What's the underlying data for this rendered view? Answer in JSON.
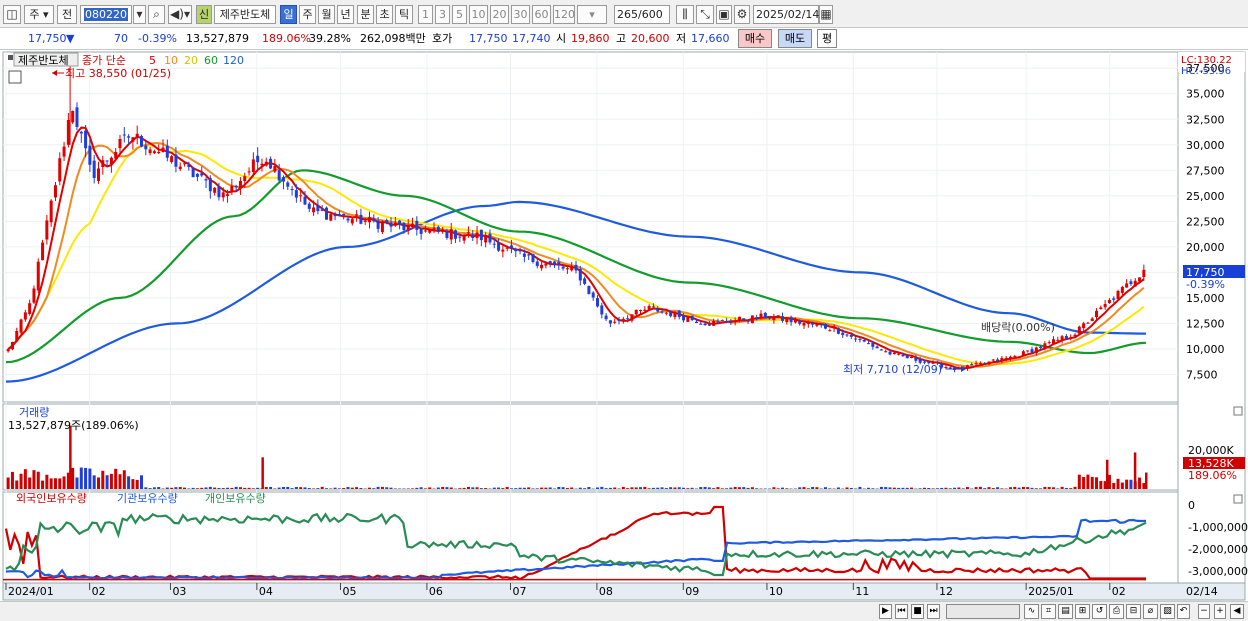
{
  "toolbar": {
    "market_label": "주",
    "range_label": "전",
    "code": "080220",
    "new_badge": "신",
    "stock_name": "제주반도체",
    "periods": [
      "일",
      "주",
      "월",
      "년",
      "분",
      "초",
      "틱"
    ],
    "selected_period": "일",
    "intervals": [
      "1",
      "3",
      "5",
      "10",
      "20",
      "30",
      "60",
      "120"
    ],
    "count": "265",
    "count_max": "/600",
    "date": "2025/02/14"
  },
  "quote": {
    "price": "17,750",
    "direction": "▼",
    "change": "70",
    "change_pct": "-0.39%",
    "volume": "13,527,879",
    "volume_ratio": "189.06%",
    "turnover_ratio": "39.28%",
    "amount": "262,098백만",
    "bid_label": "호가",
    "ask_price": "17,750",
    "bid_price": "17,740",
    "open_label": "시",
    "open": "19,860",
    "high_label": "고",
    "high": "20,600",
    "low_label": "저",
    "low": "17,660",
    "buy_button": "매수",
    "sell_button": "매도",
    "avg_button": "평"
  },
  "price_panel": {
    "stock_name": "제주반도체",
    "ma_legend_prefix": "종가 단순",
    "ma_periods": [
      "5",
      "10",
      "20",
      "60",
      "120"
    ],
    "ma_colors": [
      "#e00000",
      "#f08a20",
      "#ffe800",
      "#129c2c",
      "#1f5be0"
    ],
    "lc": "LC:130.22",
    "hc": "HC:-53.96",
    "high_annotation": "최고 38,550 (01/25)",
    "low_annotation": "최저 7,710 (12/09)",
    "dividend_annotation": "배당락(0.00%)",
    "y_ticks": [
      "37,500",
      "35,000",
      "32,500",
      "30,000",
      "27,500",
      "25,000",
      "22,500",
      "20,000",
      "17,500",
      "15,000",
      "12,500",
      "10,000",
      "7,500"
    ],
    "current_price": "17,750",
    "current_change": "-0.39%"
  },
  "volume_panel": {
    "title": "거래량",
    "value_label": "13,527,879주(189.06%)",
    "y_tick": "20,000K",
    "current_volume": "13,528K",
    "current_ratio": "189.06%"
  },
  "holdings_panel": {
    "legend": [
      "외국인보유수량",
      "기관보유수량",
      "개인보유수량"
    ],
    "legend_colors": [
      "#d00000",
      "#1f5be0",
      "#2a8c55"
    ],
    "y_ticks": [
      "0",
      "-1,000,000",
      "-2,000,000",
      "-3,000,000"
    ]
  },
  "x_axis": {
    "labels": [
      "2024/01",
      "02",
      "03",
      "04",
      "05",
      "06",
      "07",
      "08",
      "09",
      "10",
      "11",
      "12",
      "2025/01",
      "02"
    ],
    "end_label": "02/14"
  },
  "chart_data": {
    "type": "candlestick",
    "period": "daily",
    "high_marker": {
      "date": "2024/01/25",
      "value": 38550
    },
    "low_marker": {
      "date": "2024/12/09",
      "value": 7710
    },
    "price_anchors": [
      {
        "date": "2024/01/02",
        "close": 9900
      },
      {
        "date": "2024/01/10",
        "close": 14500
      },
      {
        "date": "2024/01/25",
        "close": 34000
      },
      {
        "date": "2024/02/01",
        "close": 27000
      },
      {
        "date": "2024/02/15",
        "close": 31000
      },
      {
        "date": "2024/03/01",
        "close": 28500
      },
      {
        "date": "2024/03/20",
        "close": 25000
      },
      {
        "date": "2024/04/03",
        "close": 29000
      },
      {
        "date": "2024/04/20",
        "close": 23500
      },
      {
        "date": "2024/05/10",
        "close": 22500
      },
      {
        "date": "2024/06/01",
        "close": 21500
      },
      {
        "date": "2024/06/20",
        "close": 21000
      },
      {
        "date": "2024/07/05",
        "close": 19000
      },
      {
        "date": "2024/07/25",
        "close": 17500
      },
      {
        "date": "2024/08/05",
        "close": 12500
      },
      {
        "date": "2024/08/20",
        "close": 14000
      },
      {
        "date": "2024/09/10",
        "close": 12500
      },
      {
        "date": "2024/10/01",
        "close": 13200
      },
      {
        "date": "2024/10/25",
        "close": 12000
      },
      {
        "date": "2024/11/15",
        "close": 9500
      },
      {
        "date": "2024/12/09",
        "close": 8000
      },
      {
        "date": "2024/12/30",
        "close": 9300
      },
      {
        "date": "2025/01/20",
        "close": 11500
      },
      {
        "date": "2025/02/05",
        "close": 15500
      },
      {
        "date": "2025/02/14",
        "close": 17750
      }
    ],
    "ma_anchors": {
      "ma20": [
        [
          0,
          7000
        ],
        [
          0.05,
          13000
        ],
        [
          0.1,
          30000
        ],
        [
          0.2,
          27000
        ],
        [
          0.3,
          24000
        ],
        [
          0.45,
          21500
        ],
        [
          0.6,
          14500
        ],
        [
          0.8,
          11500
        ],
        [
          0.9,
          8800
        ],
        [
          0.96,
          10500
        ],
        [
          1,
          14000
        ]
      ],
      "ma60": [
        [
          0,
          8700
        ],
        [
          0.1,
          15000
        ],
        [
          0.2,
          23000
        ],
        [
          0.26,
          27500
        ],
        [
          0.35,
          25000
        ],
        [
          0.45,
          21500
        ],
        [
          0.6,
          16500
        ],
        [
          0.75,
          13000
        ],
        [
          0.88,
          10700
        ],
        [
          0.95,
          9600
        ],
        [
          1,
          10600
        ]
      ],
      "ma120": [
        [
          0,
          6800
        ],
        [
          0.15,
          12500
        ],
        [
          0.3,
          20000
        ],
        [
          0.42,
          24000
        ],
        [
          0.45,
          24400
        ],
        [
          0.6,
          21000
        ],
        [
          0.75,
          17500
        ],
        [
          0.88,
          13500
        ],
        [
          0.95,
          11600
        ],
        [
          1,
          11500
        ]
      ]
    },
    "volume_spikes_k": [
      {
        "date": "2024/01/25",
        "value": 52000
      },
      {
        "date": "2024/04/03",
        "value": 26000
      },
      {
        "date": "2025/01/31",
        "value": 24000
      },
      {
        "date": "2025/02/10",
        "value": 30000
      },
      {
        "date": "2025/02/14",
        "value": 13528
      }
    ],
    "holdings_range": [
      -3300000,
      200000
    ]
  }
}
